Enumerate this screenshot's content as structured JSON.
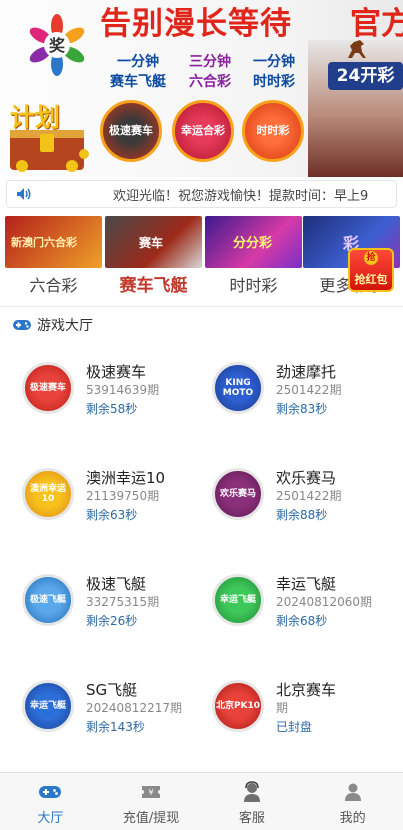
{
  "banner": {
    "headline": "告别漫长等待",
    "headline_right": "官方",
    "logo_char": "奖",
    "promos": [
      {
        "line1": "一分钟",
        "line2": "赛车飞艇"
      },
      {
        "line1": "三分钟",
        "line2": "六合彩"
      },
      {
        "line1": "一分钟",
        "line2": "时时彩"
      }
    ],
    "tag_24": "24开彩",
    "plan_text": "计划",
    "coins": [
      "极速赛车",
      "幸运合彩",
      "时时彩"
    ]
  },
  "notice": {
    "text": "欢迎光临！祝您游戏愉快！提款时间：早上9"
  },
  "categories": [
    {
      "label": "六合彩",
      "thumb_text": "新澳门六合彩",
      "active": false
    },
    {
      "label": "赛车飞艇",
      "thumb_text": "赛车",
      "active": true
    },
    {
      "label": "时时彩",
      "thumb_text": "分分彩",
      "active": false
    },
    {
      "label": "更多彩票",
      "thumb_text": "彩",
      "active": false
    }
  ],
  "red_packet": {
    "label": "抢红包",
    "seal": "抢"
  },
  "lobby": {
    "title": "游戏大厅",
    "games": [
      {
        "name": "极速赛车",
        "period": "53914639期",
        "remain": "剩余58秒",
        "icon_text": "极速赛车"
      },
      {
        "name": "劲速摩托",
        "period": "2501422期",
        "remain": "剩余83秒",
        "icon_text": "KING MOTO"
      },
      {
        "name": "澳洲幸运10",
        "period": "21139750期",
        "remain": "剩余63秒",
        "icon_text": "澳洲幸运10"
      },
      {
        "name": "欢乐赛马",
        "period": "2501422期",
        "remain": "剩余88秒",
        "icon_text": "欢乐赛马"
      },
      {
        "name": "极速飞艇",
        "period": "33275315期",
        "remain": "剩余26秒",
        "icon_text": "极速飞艇"
      },
      {
        "name": "幸运飞艇",
        "period": "20240812060期",
        "remain": "剩余68秒",
        "icon_text": "幸运飞艇"
      },
      {
        "name": "SG飞艇",
        "period": "20240812217期",
        "remain": "剩余143秒",
        "icon_text": "幸运飞艇"
      },
      {
        "name": "北京赛车",
        "period": "期",
        "remain": "已封盘",
        "icon_text": "北京PK10"
      }
    ]
  },
  "tabbar": [
    {
      "label": "大厅",
      "icon": "gamepad-icon",
      "active": true
    },
    {
      "label": "充值/提现",
      "icon": "ticket-icon",
      "active": false
    },
    {
      "label": "客服",
      "icon": "agent-icon",
      "active": false
    },
    {
      "label": "我的",
      "icon": "user-icon",
      "active": false
    }
  ],
  "colors": {
    "accent": "#2b77c9",
    "red": "#e0261b",
    "remain": "#2d6aa3"
  }
}
